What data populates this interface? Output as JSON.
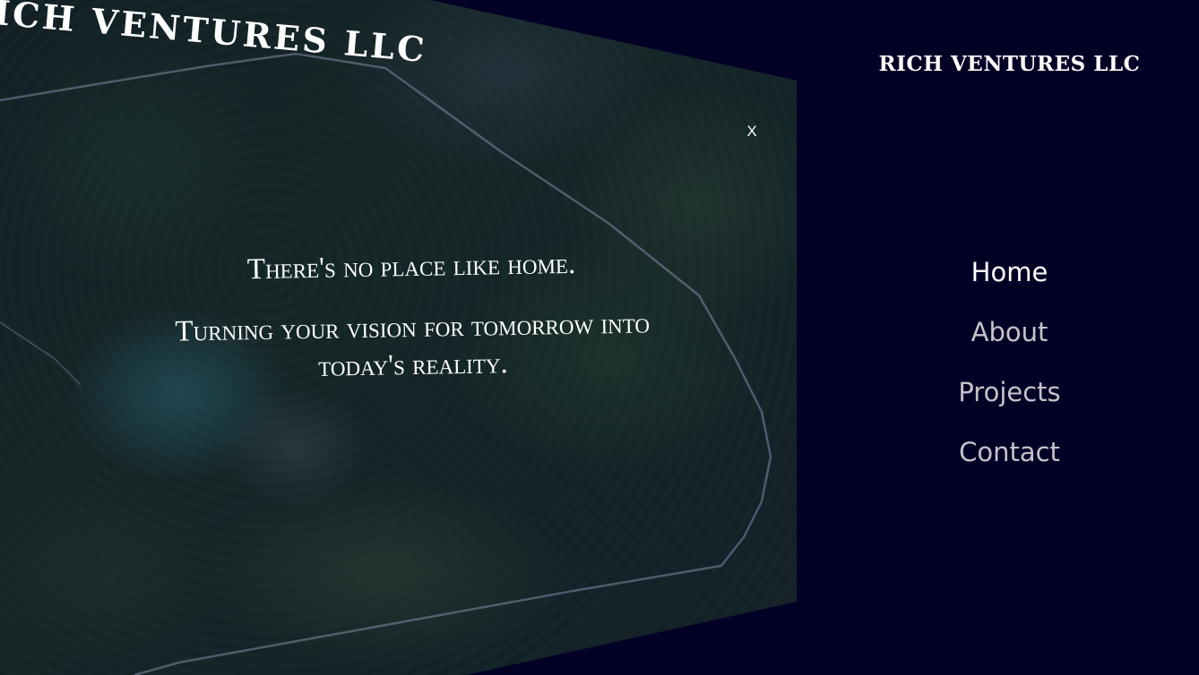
{
  "hero": {
    "logo_text": "RICH VENTURES LLC",
    "close_label": "X",
    "tagline": "There's no place like home.",
    "mission": "Turning your vision for tomorrow into today's reality."
  },
  "sidebar": {
    "brand": "RICH VENTURES LLC",
    "nav": [
      {
        "label": "Home",
        "active": true
      },
      {
        "label": "About",
        "active": false
      },
      {
        "label": "Projects",
        "active": false
      },
      {
        "label": "Contact",
        "active": false
      }
    ]
  },
  "colors": {
    "background": "#030026",
    "text": "#ffffff",
    "nav_inactive": "#c3c3c9"
  },
  "icons": {
    "close": "close-icon"
  }
}
